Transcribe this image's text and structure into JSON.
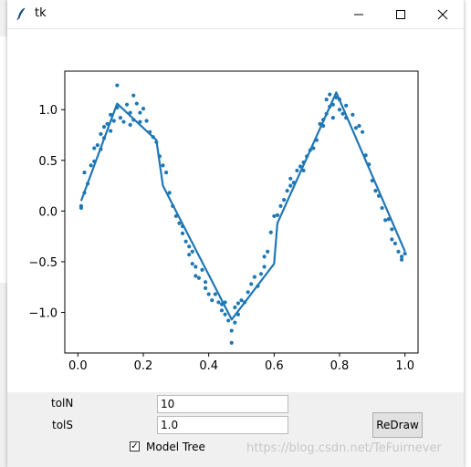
{
  "window": {
    "title": "tk"
  },
  "controls": {
    "tolN_label": "tolN",
    "tolN_value": "10",
    "tolS_label": "tolS",
    "tolS_value": "1.0",
    "redraw_label": "ReDraw",
    "model_tree_label": "Model Tree",
    "model_tree_checked": true
  },
  "watermark": "https://blog.csdn.net/TeFuirnever",
  "chart_data": {
    "type": "scatter",
    "xlim": [
      -0.04,
      1.04
    ],
    "ylim": [
      -1.4,
      1.38
    ],
    "xticks": [
      "0.0",
      "0.2",
      "0.4",
      "0.6",
      "0.8",
      "1.0"
    ],
    "yticks": [
      "1.0",
      "0.5",
      "0.0",
      "−0.5",
      "−1.0"
    ],
    "series": [
      {
        "kind": "scatter",
        "color": "#1f77b4",
        "points": [
          [
            0.01,
            0.05
          ],
          [
            0.01,
            0.03
          ],
          [
            0.02,
            0.38
          ],
          [
            0.02,
            0.18
          ],
          [
            0.03,
            0.27
          ],
          [
            0.04,
            0.45
          ],
          [
            0.05,
            0.49
          ],
          [
            0.05,
            0.62
          ],
          [
            0.06,
            0.65
          ],
          [
            0.07,
            0.61
          ],
          [
            0.07,
            0.76
          ],
          [
            0.08,
            0.72
          ],
          [
            0.08,
            0.83
          ],
          [
            0.09,
            0.86
          ],
          [
            0.1,
            0.79
          ],
          [
            0.1,
            0.95
          ],
          [
            0.11,
            0.89
          ],
          [
            0.12,
            1.24
          ],
          [
            0.12,
            1.02
          ],
          [
            0.13,
            0.92
          ],
          [
            0.14,
            0.88
          ],
          [
            0.15,
            1.05
          ],
          [
            0.16,
            0.97
          ],
          [
            0.16,
            0.85
          ],
          [
            0.17,
            1.14
          ],
          [
            0.17,
            0.9
          ],
          [
            0.18,
            1.06
          ],
          [
            0.19,
            0.97
          ],
          [
            0.19,
            0.88
          ],
          [
            0.2,
            1.01
          ],
          [
            0.21,
            0.89
          ],
          [
            0.22,
            0.78
          ],
          [
            0.23,
            0.73
          ],
          [
            0.24,
            0.68
          ],
          [
            0.25,
            0.54
          ],
          [
            0.26,
            0.45
          ],
          [
            0.27,
            0.38
          ],
          [
            0.28,
            0.18
          ],
          [
            0.29,
            0.05
          ],
          [
            0.3,
            -0.05
          ],
          [
            0.31,
            -0.12
          ],
          [
            0.32,
            -0.15
          ],
          [
            0.32,
            -0.22
          ],
          [
            0.33,
            -0.3
          ],
          [
            0.34,
            -0.35
          ],
          [
            0.34,
            -0.43
          ],
          [
            0.35,
            -0.4
          ],
          [
            0.35,
            -0.52
          ],
          [
            0.36,
            -0.55
          ],
          [
            0.36,
            -0.64
          ],
          [
            0.37,
            -0.66
          ],
          [
            0.38,
            -0.58
          ],
          [
            0.39,
            -0.7
          ],
          [
            0.39,
            -0.76
          ],
          [
            0.4,
            -0.82
          ],
          [
            0.41,
            -0.88
          ],
          [
            0.42,
            -0.82
          ],
          [
            0.43,
            -0.9
          ],
          [
            0.44,
            -0.92
          ],
          [
            0.44,
            -0.98
          ],
          [
            0.45,
            -0.9
          ],
          [
            0.45,
            -1.02
          ],
          [
            0.46,
            -1.08
          ],
          [
            0.47,
            -1.18
          ],
          [
            0.47,
            -1.3
          ],
          [
            0.48,
            -1.1
          ],
          [
            0.48,
            -0.95
          ],
          [
            0.49,
            -0.91
          ],
          [
            0.49,
            -1.02
          ],
          [
            0.5,
            -0.88
          ],
          [
            0.51,
            -0.9
          ],
          [
            0.52,
            -0.8
          ],
          [
            0.53,
            -0.72
          ],
          [
            0.54,
            -0.65
          ],
          [
            0.55,
            -0.74
          ],
          [
            0.56,
            -0.62
          ],
          [
            0.57,
            -0.55
          ],
          [
            0.57,
            -0.45
          ],
          [
            0.58,
            -0.4
          ],
          [
            0.59,
            -0.21
          ],
          [
            0.6,
            -0.05
          ],
          [
            0.61,
            -0.04
          ],
          [
            0.62,
            0.05
          ],
          [
            0.63,
            0.11
          ],
          [
            0.64,
            0.2
          ],
          [
            0.65,
            0.25
          ],
          [
            0.65,
            0.32
          ],
          [
            0.66,
            0.28
          ],
          [
            0.67,
            0.4
          ],
          [
            0.68,
            0.44
          ],
          [
            0.69,
            0.48
          ],
          [
            0.69,
            0.4
          ],
          [
            0.7,
            0.54
          ],
          [
            0.71,
            0.6
          ],
          [
            0.72,
            0.62
          ],
          [
            0.73,
            0.7
          ],
          [
            0.74,
            0.86
          ],
          [
            0.75,
            0.9
          ],
          [
            0.75,
            0.84
          ],
          [
            0.76,
            0.96
          ],
          [
            0.76,
            1.1
          ],
          [
            0.77,
            1.03
          ],
          [
            0.77,
            1.15
          ],
          [
            0.78,
            0.92
          ],
          [
            0.78,
            1.05
          ],
          [
            0.79,
            1.12
          ],
          [
            0.8,
            1.1
          ],
          [
            0.8,
            1.0
          ],
          [
            0.81,
            0.96
          ],
          [
            0.82,
            0.92
          ],
          [
            0.82,
            1.04
          ],
          [
            0.84,
            0.95
          ],
          [
            0.85,
            0.82
          ],
          [
            0.86,
            0.84
          ],
          [
            0.87,
            0.78
          ],
          [
            0.88,
            0.55
          ],
          [
            0.89,
            0.46
          ],
          [
            0.9,
            0.3
          ],
          [
            0.91,
            0.2
          ],
          [
            0.92,
            0.15
          ],
          [
            0.93,
            0.03
          ],
          [
            0.94,
            -0.09
          ],
          [
            0.95,
            -0.08
          ],
          [
            0.96,
            -0.18
          ],
          [
            0.96,
            -0.28
          ],
          [
            0.97,
            -0.32
          ],
          [
            0.98,
            -0.4
          ],
          [
            0.99,
            -0.45
          ],
          [
            0.99,
            -0.48
          ],
          [
            1.0,
            -0.42
          ]
        ]
      },
      {
        "kind": "line",
        "color": "#1f77b4",
        "points": [
          [
            0.01,
            0.1
          ],
          [
            0.12,
            1.06
          ],
          [
            0.24,
            0.7
          ],
          [
            0.26,
            0.25
          ],
          [
            0.47,
            -1.07
          ],
          [
            0.6,
            -0.52
          ],
          [
            0.61,
            -0.12
          ],
          [
            0.79,
            1.17
          ],
          [
            1.0,
            -0.4
          ]
        ]
      }
    ]
  }
}
